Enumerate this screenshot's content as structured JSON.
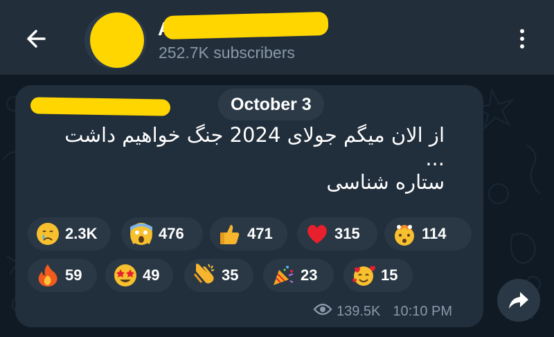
{
  "header": {
    "back_icon": "arrow-left-icon",
    "channel_name": "A",
    "subscribers": "252.7K subscribers",
    "menu_icon": "more-vertical-icon"
  },
  "message": {
    "date": "October 3",
    "lines": [
      "از الان میگم جولای 2024 جنگ خواهیم داشت",
      "...",
      "ستاره شناسی"
    ],
    "views": "139.5K",
    "time": "10:10 PM"
  },
  "reactions": [
    {
      "emoji": "crying-face",
      "count": "2.3K"
    },
    {
      "emoji": "screaming-face",
      "count": "476"
    },
    {
      "emoji": "thumbs-up",
      "count": "471"
    },
    {
      "emoji": "red-heart",
      "count": "315"
    },
    {
      "emoji": "exploding-head",
      "count": "114"
    },
    {
      "emoji": "fire",
      "count": "59"
    },
    {
      "emoji": "star-struck",
      "count": "49"
    },
    {
      "emoji": "clapping-hands",
      "count": "35"
    },
    {
      "emoji": "party-popper",
      "count": "23"
    },
    {
      "emoji": "smiling-face-with-hearts",
      "count": "15"
    }
  ],
  "colors": {
    "header_bg": "#222e3a",
    "bubble_bg": "#212e3b",
    "reaction_bg": "#2a3845",
    "muted_text": "#8a98a8",
    "redaction": "#ffd600"
  },
  "share_icon": "share-arrow-icon"
}
